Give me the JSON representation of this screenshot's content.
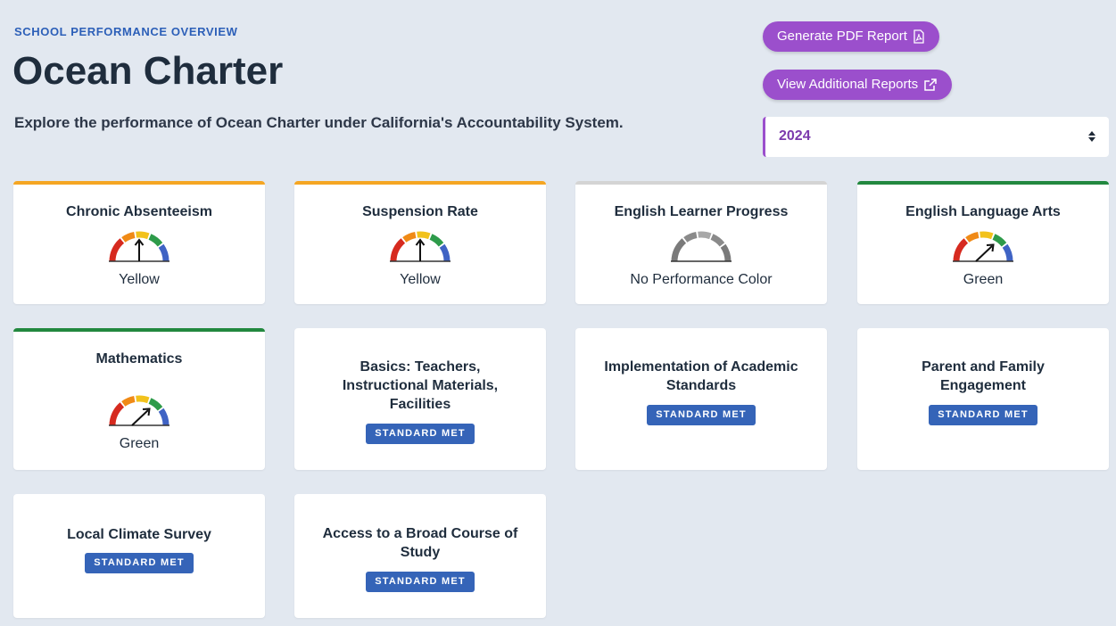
{
  "header": {
    "eyebrow": "SCHOOL PERFORMANCE OVERVIEW",
    "title": "Ocean Charter",
    "intro": "Explore the performance of Ocean Charter under California's Accountability System."
  },
  "actions": {
    "pdf_label": "Generate PDF Report",
    "reports_label": "View Additional Reports"
  },
  "year_select": {
    "value": "2024"
  },
  "colors": {
    "red": "#d62a1f",
    "orange": "#f08a16",
    "yellow": "#f2c21b",
    "green": "#2e9b4a",
    "blue": "#3f63c4",
    "gray": "#7a7a7a",
    "accent_purple": "#9b4fcc",
    "badge_blue": "#3564b8"
  },
  "cards": [
    {
      "title": "Chronic Absenteeism",
      "status": "Yellow"
    },
    {
      "title": "Suspension Rate",
      "status": "Yellow"
    },
    {
      "title": "English Learner Progress",
      "status": "No Performance Color"
    },
    {
      "title": "English Language Arts",
      "status": "Green"
    },
    {
      "title": "Mathematics",
      "status": "Green"
    },
    {
      "title": "Basics: Teachers, Instructional Materials, Facilities",
      "badge": "STANDARD MET"
    },
    {
      "title": "Implementation of Academic Standards",
      "badge": "STANDARD MET"
    },
    {
      "title": "Parent and Family Engagement",
      "badge": "STANDARD MET"
    },
    {
      "title": "Local Climate Survey",
      "badge": "STANDARD MET"
    },
    {
      "title": "Access to a Broad Course of Study",
      "badge": "STANDARD MET"
    }
  ]
}
